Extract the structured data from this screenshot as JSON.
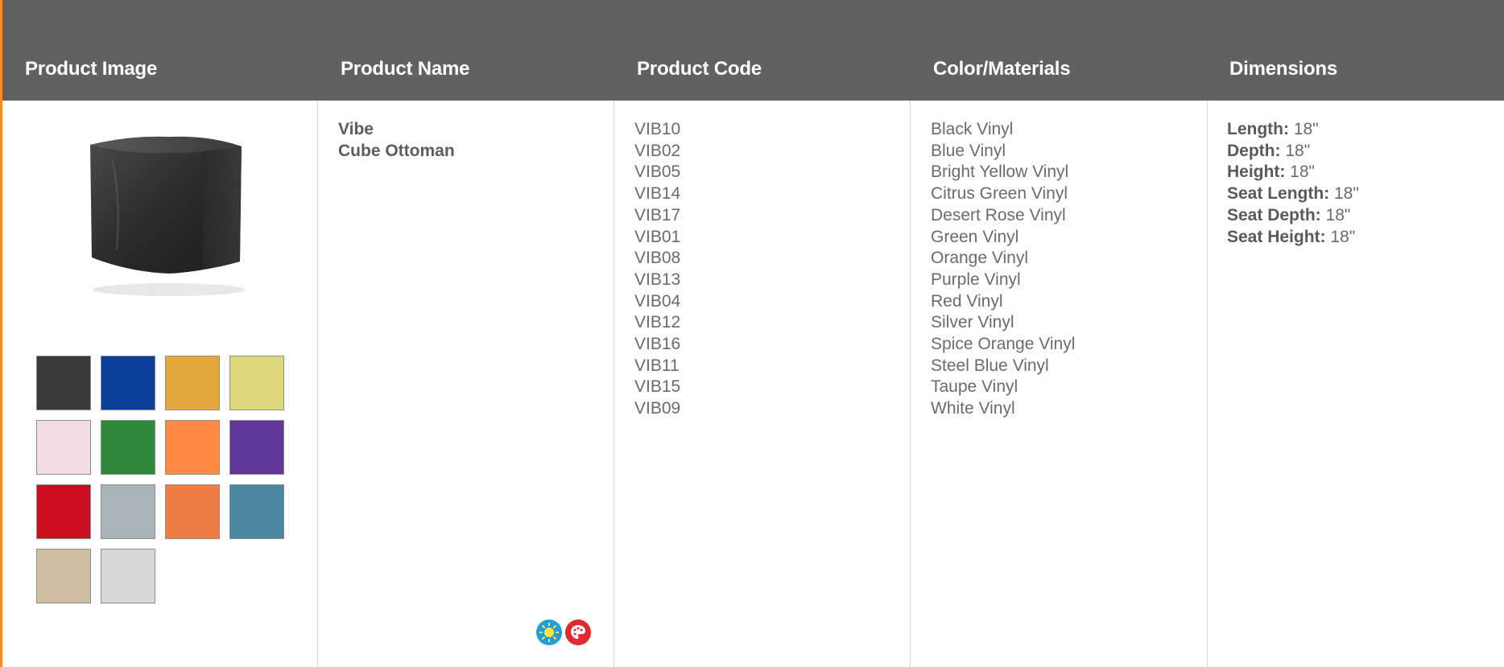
{
  "header": {
    "columns": [
      "Product Image",
      "Product Name",
      "Product Code",
      "Color/Materials",
      "Dimensions"
    ]
  },
  "product": {
    "name_line1": "Vibe",
    "name_line2": "Cube Ottoman",
    "image_icon": "cube-ottoman-image",
    "codes": [
      "VIB10",
      "VIB02",
      "VIB05",
      "VIB14",
      "VIB17",
      "VIB01",
      "VIB08",
      "VIB13",
      "VIB04",
      "VIB12",
      "VIB16",
      "VIB11",
      "VIB15",
      "VIB09"
    ],
    "colors": [
      "Black Vinyl",
      "Blue Vinyl",
      "Bright Yellow Vinyl",
      "Citrus Green Vinyl",
      "Desert Rose Vinyl",
      "Green Vinyl",
      "Orange Vinyl",
      "Purple Vinyl",
      "Red Vinyl",
      "Silver Vinyl",
      "Spice Orange Vinyl",
      "Steel Blue Vinyl",
      "Taupe Vinyl",
      "White Vinyl"
    ],
    "swatch_colors": [
      "#3a3a3a",
      "#0b3f9a",
      "#e2a73c",
      "#dcd87a",
      "#f3dde0",
      "#2e8a3a",
      "#ff8a45",
      "#5f3597",
      "#cc0f1f",
      "#a9b4b8",
      "#ef7c45",
      "#4c87a2",
      "#cdbfa0",
      "#d6d7d7"
    ],
    "dimensions": [
      {
        "label": "Length:",
        "value": "18\""
      },
      {
        "label": "Depth:",
        "value": "18\""
      },
      {
        "label": "Height:",
        "value": "18\""
      },
      {
        "label": "Seat Length:",
        "value": "18\""
      },
      {
        "label": "Seat Depth:",
        "value": "18\""
      },
      {
        "label": "Seat Height:",
        "value": "18\""
      }
    ],
    "badges": [
      {
        "icon": "uv-sun-icon",
        "color": "#1e9fd8"
      },
      {
        "icon": "color-palette-icon",
        "color": "#e02a32"
      }
    ]
  },
  "theme": {
    "accent": "#f28c28",
    "header_bg": "#616161"
  }
}
